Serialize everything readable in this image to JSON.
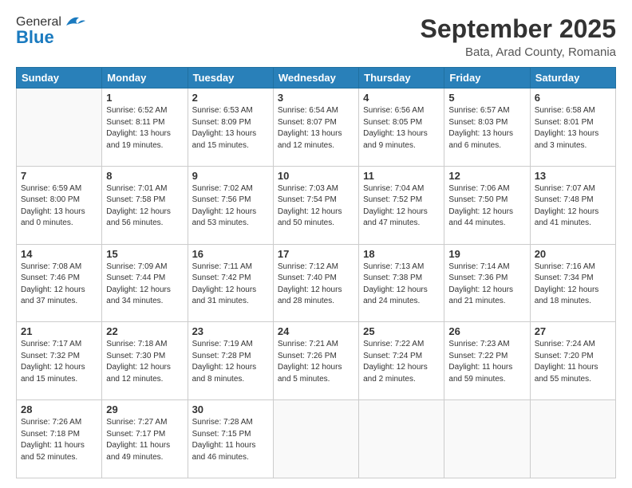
{
  "header": {
    "logo_general": "General",
    "logo_blue": "Blue",
    "month": "September 2025",
    "location": "Bata, Arad County, Romania"
  },
  "weekdays": [
    "Sunday",
    "Monday",
    "Tuesday",
    "Wednesday",
    "Thursday",
    "Friday",
    "Saturday"
  ],
  "weeks": [
    [
      {
        "day": "",
        "info": ""
      },
      {
        "day": "1",
        "info": "Sunrise: 6:52 AM\nSunset: 8:11 PM\nDaylight: 13 hours\nand 19 minutes."
      },
      {
        "day": "2",
        "info": "Sunrise: 6:53 AM\nSunset: 8:09 PM\nDaylight: 13 hours\nand 15 minutes."
      },
      {
        "day": "3",
        "info": "Sunrise: 6:54 AM\nSunset: 8:07 PM\nDaylight: 13 hours\nand 12 minutes."
      },
      {
        "day": "4",
        "info": "Sunrise: 6:56 AM\nSunset: 8:05 PM\nDaylight: 13 hours\nand 9 minutes."
      },
      {
        "day": "5",
        "info": "Sunrise: 6:57 AM\nSunset: 8:03 PM\nDaylight: 13 hours\nand 6 minutes."
      },
      {
        "day": "6",
        "info": "Sunrise: 6:58 AM\nSunset: 8:01 PM\nDaylight: 13 hours\nand 3 minutes."
      }
    ],
    [
      {
        "day": "7",
        "info": "Sunrise: 6:59 AM\nSunset: 8:00 PM\nDaylight: 13 hours\nand 0 minutes."
      },
      {
        "day": "8",
        "info": "Sunrise: 7:01 AM\nSunset: 7:58 PM\nDaylight: 12 hours\nand 56 minutes."
      },
      {
        "day": "9",
        "info": "Sunrise: 7:02 AM\nSunset: 7:56 PM\nDaylight: 12 hours\nand 53 minutes."
      },
      {
        "day": "10",
        "info": "Sunrise: 7:03 AM\nSunset: 7:54 PM\nDaylight: 12 hours\nand 50 minutes."
      },
      {
        "day": "11",
        "info": "Sunrise: 7:04 AM\nSunset: 7:52 PM\nDaylight: 12 hours\nand 47 minutes."
      },
      {
        "day": "12",
        "info": "Sunrise: 7:06 AM\nSunset: 7:50 PM\nDaylight: 12 hours\nand 44 minutes."
      },
      {
        "day": "13",
        "info": "Sunrise: 7:07 AM\nSunset: 7:48 PM\nDaylight: 12 hours\nand 41 minutes."
      }
    ],
    [
      {
        "day": "14",
        "info": "Sunrise: 7:08 AM\nSunset: 7:46 PM\nDaylight: 12 hours\nand 37 minutes."
      },
      {
        "day": "15",
        "info": "Sunrise: 7:09 AM\nSunset: 7:44 PM\nDaylight: 12 hours\nand 34 minutes."
      },
      {
        "day": "16",
        "info": "Sunrise: 7:11 AM\nSunset: 7:42 PM\nDaylight: 12 hours\nand 31 minutes."
      },
      {
        "day": "17",
        "info": "Sunrise: 7:12 AM\nSunset: 7:40 PM\nDaylight: 12 hours\nand 28 minutes."
      },
      {
        "day": "18",
        "info": "Sunrise: 7:13 AM\nSunset: 7:38 PM\nDaylight: 12 hours\nand 24 minutes."
      },
      {
        "day": "19",
        "info": "Sunrise: 7:14 AM\nSunset: 7:36 PM\nDaylight: 12 hours\nand 21 minutes."
      },
      {
        "day": "20",
        "info": "Sunrise: 7:16 AM\nSunset: 7:34 PM\nDaylight: 12 hours\nand 18 minutes."
      }
    ],
    [
      {
        "day": "21",
        "info": "Sunrise: 7:17 AM\nSunset: 7:32 PM\nDaylight: 12 hours\nand 15 minutes."
      },
      {
        "day": "22",
        "info": "Sunrise: 7:18 AM\nSunset: 7:30 PM\nDaylight: 12 hours\nand 12 minutes."
      },
      {
        "day": "23",
        "info": "Sunrise: 7:19 AM\nSunset: 7:28 PM\nDaylight: 12 hours\nand 8 minutes."
      },
      {
        "day": "24",
        "info": "Sunrise: 7:21 AM\nSunset: 7:26 PM\nDaylight: 12 hours\nand 5 minutes."
      },
      {
        "day": "25",
        "info": "Sunrise: 7:22 AM\nSunset: 7:24 PM\nDaylight: 12 hours\nand 2 minutes."
      },
      {
        "day": "26",
        "info": "Sunrise: 7:23 AM\nSunset: 7:22 PM\nDaylight: 11 hours\nand 59 minutes."
      },
      {
        "day": "27",
        "info": "Sunrise: 7:24 AM\nSunset: 7:20 PM\nDaylight: 11 hours\nand 55 minutes."
      }
    ],
    [
      {
        "day": "28",
        "info": "Sunrise: 7:26 AM\nSunset: 7:18 PM\nDaylight: 11 hours\nand 52 minutes."
      },
      {
        "day": "29",
        "info": "Sunrise: 7:27 AM\nSunset: 7:17 PM\nDaylight: 11 hours\nand 49 minutes."
      },
      {
        "day": "30",
        "info": "Sunrise: 7:28 AM\nSunset: 7:15 PM\nDaylight: 11 hours\nand 46 minutes."
      },
      {
        "day": "",
        "info": ""
      },
      {
        "day": "",
        "info": ""
      },
      {
        "day": "",
        "info": ""
      },
      {
        "day": "",
        "info": ""
      }
    ]
  ]
}
